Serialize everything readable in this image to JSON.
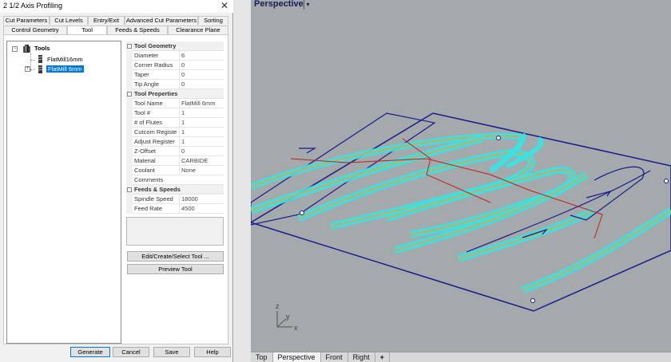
{
  "dialog": {
    "title": "2 1/2 Axis Profiling",
    "close_glyph": "✕",
    "tabs_row1": [
      "Cut Parameters",
      "Cut Levels",
      "Entry/Exit",
      "Advanced Cut Parameters",
      "Sorting"
    ],
    "tabs_row2": [
      "Control Geometry",
      "Tool",
      "Feeds & Speeds",
      "Clearance Plane"
    ],
    "active_tab": "Tool"
  },
  "tree": {
    "root": "Tools",
    "items": [
      {
        "label": "FlatMill16mm",
        "selected": false
      },
      {
        "label": "FlatMill 6mm",
        "selected": true
      }
    ]
  },
  "properties": {
    "categories": [
      {
        "name": "Tool Geometry",
        "rows": [
          {
            "name": "Diameter",
            "value": "6"
          },
          {
            "name": "Corner Radius",
            "value": "0"
          },
          {
            "name": "Taper",
            "value": "0"
          },
          {
            "name": "Tip Angle",
            "value": "0"
          }
        ]
      },
      {
        "name": "Tool Properties",
        "rows": [
          {
            "name": "Tool Name",
            "value": "FlatMill 6mm"
          },
          {
            "name": "Tool #",
            "value": "1"
          },
          {
            "name": "# of Flutes",
            "value": "1"
          },
          {
            "name": "Cutcom Registe",
            "value": "1"
          },
          {
            "name": "Adjust Register",
            "value": "1"
          },
          {
            "name": "Z-Offset",
            "value": "0"
          },
          {
            "name": "Material",
            "value": "CARBIDE"
          },
          {
            "name": "Coolant",
            "value": "None"
          },
          {
            "name": "Comments",
            "value": ""
          }
        ]
      },
      {
        "name": "Feeds & Speeds",
        "rows": [
          {
            "name": "Spindle Speed",
            "value": "18000"
          },
          {
            "name": "Feed Rate",
            "value": "4500"
          }
        ]
      }
    ]
  },
  "buttons": {
    "edit_tool": "Edit/Create/Select Tool ...",
    "preview_tool": "Preview Tool",
    "generate": "Generate",
    "cancel": "Cancel",
    "save": "Save",
    "help": "Help"
  },
  "viewport": {
    "title": "Perspective",
    "menu_glyph": "▾",
    "axes": {
      "x": "x",
      "y": "y",
      "z": "z"
    },
    "tabs": [
      "Top",
      "Perspective",
      "Front",
      "Right"
    ],
    "active_tab": "Perspective",
    "add_tab_glyph": "+",
    "colors": {
      "background": "#a4a9ac",
      "boundary": "#1a1a8c",
      "toolpath": "#3fe0e0",
      "cut": "#e8a040",
      "rapid": "#c02020"
    }
  }
}
